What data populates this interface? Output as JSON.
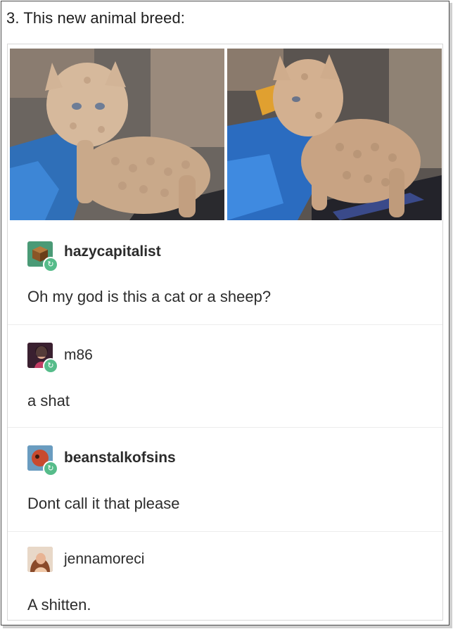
{
  "heading": "3. This new animal breed:",
  "photos": [
    {
      "icon": "curly-kitten-photo-1"
    },
    {
      "icon": "curly-kitten-photo-2"
    }
  ],
  "posts": [
    {
      "username": "hazycapitalist",
      "comment": "Oh my god is this a cat or a sheep?",
      "avatar_icon": "cube-avatar-icon",
      "avatar_color": "#4a9a76"
    },
    {
      "username": "m86",
      "comment": "a shat",
      "avatar_icon": "portrait-avatar-icon",
      "avatar_color": "#b03a5a"
    },
    {
      "username": "beanstalkofsins",
      "comment": "Dont call it that please",
      "avatar_icon": "face-avatar-icon",
      "avatar_color": "#5a8fb0"
    },
    {
      "username": "jennamoreci",
      "comment": "A shitten.",
      "avatar_icon": "photo-avatar-icon",
      "avatar_color": "#c98a6a"
    }
  ],
  "colors": {
    "reblog_badge": "#56bc8a",
    "text": "#2c2c2c",
    "divider": "#ececec"
  }
}
